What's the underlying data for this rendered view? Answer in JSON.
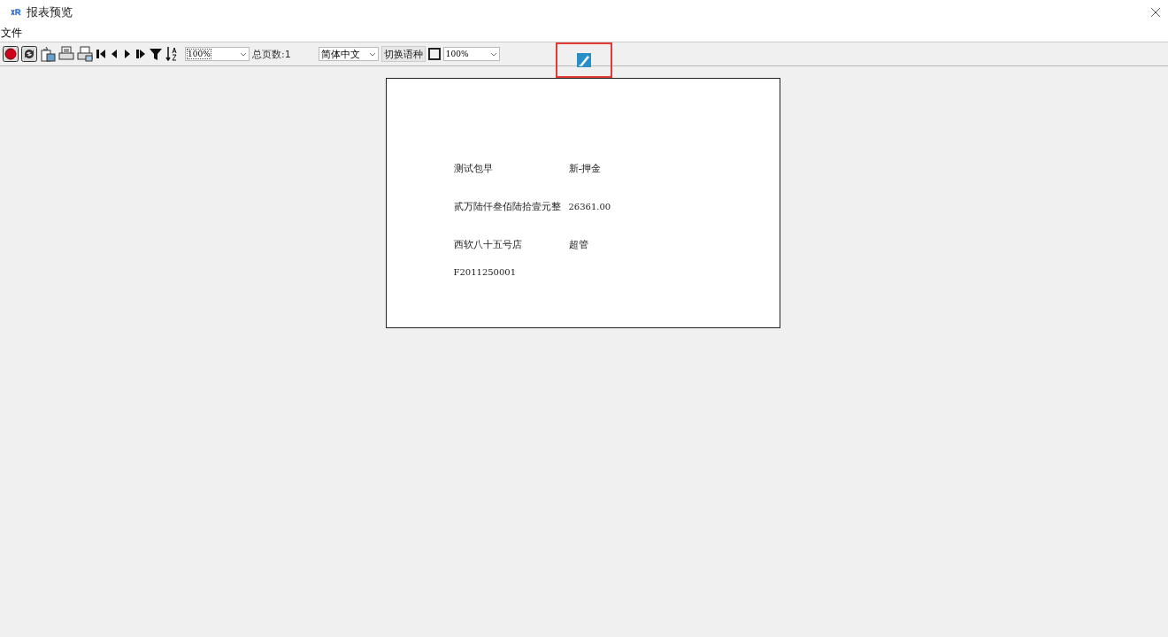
{
  "window": {
    "title": "报表预览"
  },
  "menu": [
    "文件"
  ],
  "toolbar": {
    "zoom": {
      "value": "100%"
    },
    "page_count": "总页数:1",
    "language": {
      "value": "简体中文"
    },
    "switch_button": "切换语种",
    "checkbox": {
      "checked": false
    },
    "zoom_2": {
      "value": "100%"
    }
  },
  "report": {
    "rows": [
      {
        "column_1": "测试包早",
        "column_2": "新-押金"
      },
      {
        "column_1": "贰万陆仟叁佰陆拾壹元整",
        "column_2": "26361.00"
      },
      {
        "column_1": "西软八十五号店",
        "column_2": "超管"
      },
      {
        "column_1": "F2011250001"
      }
    ]
  }
}
